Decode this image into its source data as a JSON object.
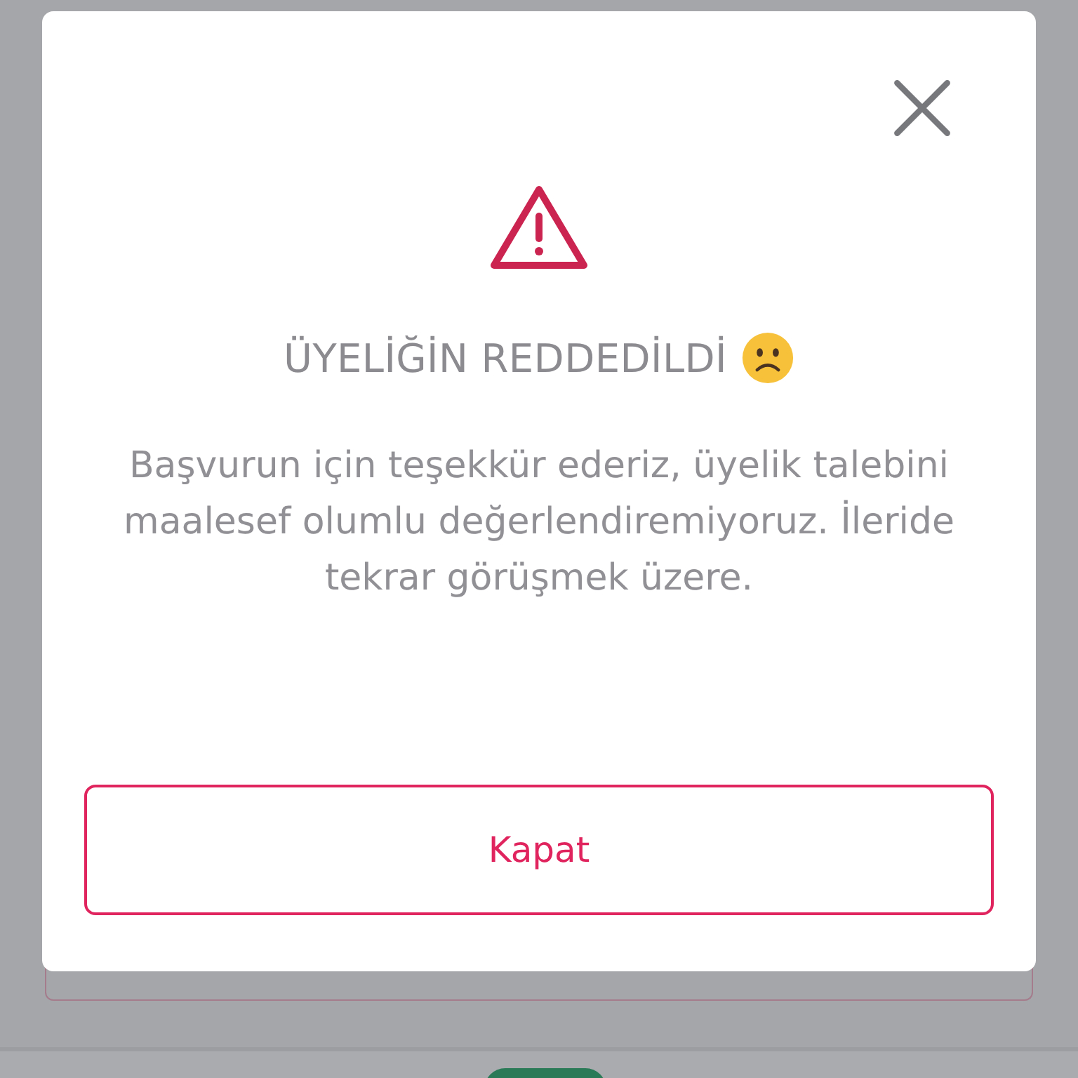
{
  "dialog": {
    "title": "ÜYELİĞİN REDDEDİLDİ",
    "message": "Başvurun için teşekkür ederiz, üyelik talebini maalesef olumlu değerlendiremiyoruz. İleride tekrar görüşmek üzere.",
    "button": "Kapat"
  }
}
